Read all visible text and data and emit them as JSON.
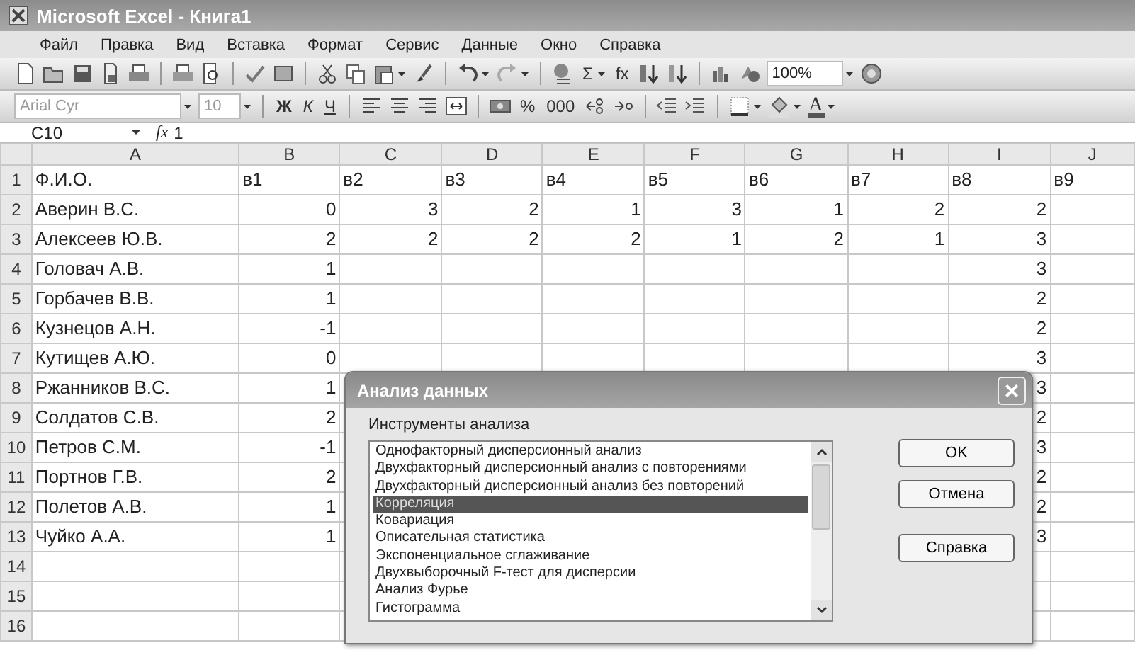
{
  "window": {
    "title": "Microsoft Excel - Книга1"
  },
  "menu": [
    "Файл",
    "Правка",
    "Вид",
    "Вставка",
    "Формат",
    "Сервис",
    "Данные",
    "Окно",
    "Справка"
  ],
  "standard_toolbar": [
    {
      "kind": "new"
    },
    {
      "kind": "open"
    },
    {
      "kind": "save"
    },
    {
      "kind": "permission"
    },
    {
      "kind": "print"
    },
    {
      "kind": "sep"
    },
    {
      "kind": "print2"
    },
    {
      "kind": "preview"
    },
    {
      "kind": "sep"
    },
    {
      "kind": "spell"
    },
    {
      "kind": "research"
    },
    {
      "kind": "sep"
    },
    {
      "kind": "cut"
    },
    {
      "kind": "copy"
    },
    {
      "kind": "paste"
    },
    {
      "kind": "caret"
    },
    {
      "kind": "brush"
    },
    {
      "kind": "sep"
    },
    {
      "kind": "undo"
    },
    {
      "kind": "caret"
    },
    {
      "kind": "redo"
    },
    {
      "kind": "caret"
    },
    {
      "kind": "sep"
    },
    {
      "kind": "link"
    },
    {
      "kind": "glyph",
      "text": "Σ"
    },
    {
      "kind": "caret"
    },
    {
      "kind": "glyph",
      "text": "fx"
    },
    {
      "kind": "sortaz"
    },
    {
      "kind": "sortza"
    },
    {
      "kind": "sep"
    },
    {
      "kind": "chart"
    },
    {
      "kind": "drawing"
    },
    {
      "kind": "zoom",
      "text": "100%"
    },
    {
      "kind": "help"
    }
  ],
  "format_toolbar": [
    {
      "kind": "font",
      "text": "Arial Cyr"
    },
    {
      "kind": "size",
      "text": "10"
    },
    {
      "kind": "sep"
    },
    {
      "kind": "bold",
      "text": "Ж"
    },
    {
      "kind": "italic",
      "text": "К"
    },
    {
      "kind": "underline",
      "text": "Ч"
    },
    {
      "kind": "sep"
    },
    {
      "kind": "alignleft"
    },
    {
      "kind": "aligncenter"
    },
    {
      "kind": "alignright"
    },
    {
      "kind": "merge"
    },
    {
      "kind": "sep"
    },
    {
      "kind": "currency"
    },
    {
      "kind": "glyph",
      "text": "%"
    },
    {
      "kind": "glyph",
      "text": "000"
    },
    {
      "kind": "incdec"
    },
    {
      "kind": "decdec"
    },
    {
      "kind": "sep"
    },
    {
      "kind": "outdent"
    },
    {
      "kind": "indent"
    },
    {
      "kind": "sep"
    },
    {
      "kind": "border"
    },
    {
      "kind": "caret"
    },
    {
      "kind": "fill"
    },
    {
      "kind": "caret"
    },
    {
      "kind": "fontcolor",
      "text": "A"
    },
    {
      "kind": "caret"
    }
  ],
  "formula_bar": {
    "name_box": "C10",
    "fx": "fx",
    "value": "1"
  },
  "columns": [
    "A",
    "B",
    "C",
    "D",
    "E",
    "F",
    "G",
    "H",
    "I",
    "J"
  ],
  "rows": [
    {
      "number": "1",
      "kind": "full",
      "cells": [
        "Ф.И.О.",
        "в1",
        "в2",
        "в3",
        "в4",
        "в5",
        "в6",
        "в7",
        "в8",
        "в9"
      ]
    },
    {
      "number": "2",
      "kind": "full",
      "cells": [
        "Аверин В.С.",
        "0",
        "3",
        "2",
        "1",
        "3",
        "1",
        "2",
        "2"
      ]
    },
    {
      "number": "3",
      "kind": "full",
      "cells": [
        "Алексеев Ю.В.",
        "2",
        "2",
        "2",
        "2",
        "1",
        "2",
        "1",
        "3"
      ]
    },
    {
      "number": "4",
      "kind": "covered",
      "cells": [
        "Головач А.В.",
        "1",
        "3"
      ]
    },
    {
      "number": "5",
      "kind": "covered",
      "cells": [
        "Горбачев В.В.",
        "1",
        "2"
      ]
    },
    {
      "number": "6",
      "kind": "covered",
      "cells": [
        "Кузнецов А.Н.",
        "-1",
        "2"
      ]
    },
    {
      "number": "7",
      "kind": "covered",
      "cells": [
        "Кутищев А.Ю.",
        "0",
        "3"
      ]
    },
    {
      "number": "8",
      "kind": "covered",
      "cells": [
        "Ржанников В.С.",
        "1",
        "3"
      ]
    },
    {
      "number": "9",
      "kind": "covered",
      "cells": [
        "Солдатов С.В.",
        "2",
        "2"
      ]
    },
    {
      "number": "10",
      "kind": "covered",
      "cells": [
        "Петров С.М.",
        "-1",
        "3"
      ]
    },
    {
      "number": "11",
      "kind": "covered",
      "cells": [
        "Портнов Г.В.",
        "2",
        "2"
      ]
    },
    {
      "number": "12",
      "kind": "covered",
      "cells": [
        "Полетов А.В.",
        "1",
        "2"
      ]
    },
    {
      "number": "13",
      "kind": "covered",
      "cells": [
        "Чуйко А.А.",
        "1",
        "3"
      ]
    },
    {
      "number": "14",
      "kind": "covered",
      "cells": []
    },
    {
      "number": "15",
      "kind": "full",
      "cells": []
    },
    {
      "number": "16",
      "kind": "full",
      "cells": []
    }
  ],
  "dialog": {
    "title": "Анализ данных",
    "close": "×",
    "list_label": "Инструменты анализа",
    "tools": [
      {
        "label": "Однофакторный дисперсионный анализ",
        "selected": false
      },
      {
        "label": "Двухфакторный дисперсионный анализ с повторениями",
        "selected": false
      },
      {
        "label": "Двухфакторный дисперсионный анализ без повторений",
        "selected": false
      },
      {
        "label": "Корреляция",
        "selected": true
      },
      {
        "label": "Ковариация",
        "selected": false
      },
      {
        "label": "Описательная статистика",
        "selected": false
      },
      {
        "label": "Экспоненциальное сглаживание",
        "selected": false
      },
      {
        "label": "Двухвыборочный F-тест для дисперсии",
        "selected": false
      },
      {
        "label": "Анализ Фурье",
        "selected": false
      },
      {
        "label": "Гистограмма",
        "selected": false
      }
    ],
    "buttons": [
      "OK",
      "Отмена",
      "Справка"
    ]
  }
}
